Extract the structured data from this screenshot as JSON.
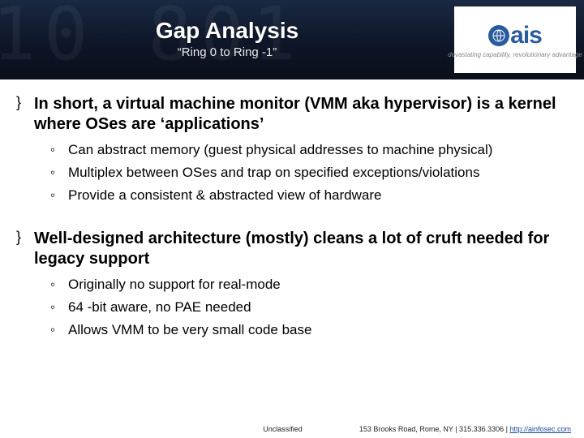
{
  "header": {
    "title": "Gap Analysis",
    "subtitle": "“Ring 0 to Ring -1”"
  },
  "logo": {
    "name": "ais",
    "tagline": "devastating capability, revolutionary advantage"
  },
  "sections": [
    {
      "heading": "In short, a virtual machine monitor (VMM aka hypervisor) is a kernel where OSes are ‘applications’",
      "items": [
        "Can abstract memory (guest physical addresses to machine physical)",
        "Multiplex between OSes and trap on specified exceptions/violations",
        "Provide a consistent & abstracted view of hardware"
      ]
    },
    {
      "heading": "Well-designed architecture (mostly) cleans a lot of cruft needed for legacy support",
      "items": [
        "Originally no support for real-mode",
        "64 -bit aware, no PAE needed",
        "Allows VMM to be very small code base"
      ]
    }
  ],
  "footer": {
    "classification": "Unclassified",
    "address": "153 Brooks Road, Rome, NY | 315.336.3306 | ",
    "link": "http://ainfosec.com"
  }
}
